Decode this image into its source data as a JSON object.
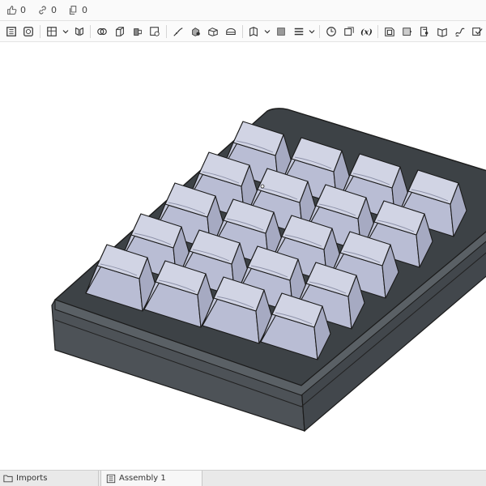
{
  "header": {
    "likes_count": "0",
    "links_count": "0",
    "copies_count": "0"
  },
  "toolbar": {
    "tools": [
      "sketch-icon",
      "3d-sketch-icon",
      "grid-icon",
      "dropdown-chevron-icon",
      "mirror-view-icon",
      "boolean-icon",
      "extrude-icon",
      "revolve-icon",
      "hole-icon",
      "fillet-icon",
      "chamfer-icon",
      "shell-icon",
      "pattern-icon",
      "plane-icon",
      "dropdown-chevron-icon",
      "transform-icon",
      "list-icon",
      "dropdown-chevron-icon",
      "measure-icon",
      "mate-icon",
      "variable-icon",
      "part-studio-icon",
      "surface-icon",
      "sheet-metal-icon",
      "split-icon",
      "curve-icon",
      "delete-face-icon"
    ]
  },
  "bottom_tabs": {
    "imports_label": "Imports",
    "assembly_label": "Assembly 1"
  },
  "viewport": {
    "model": "keypad-assembly",
    "key_rows": 5,
    "key_columns": 4,
    "key_count": 20,
    "colors": {
      "case": "#4a4f54",
      "case_top": "#3d4246",
      "keycap": "#b9bdd4",
      "keycap_top": "#d1d4e4",
      "edge": "#1b1b1b"
    }
  }
}
